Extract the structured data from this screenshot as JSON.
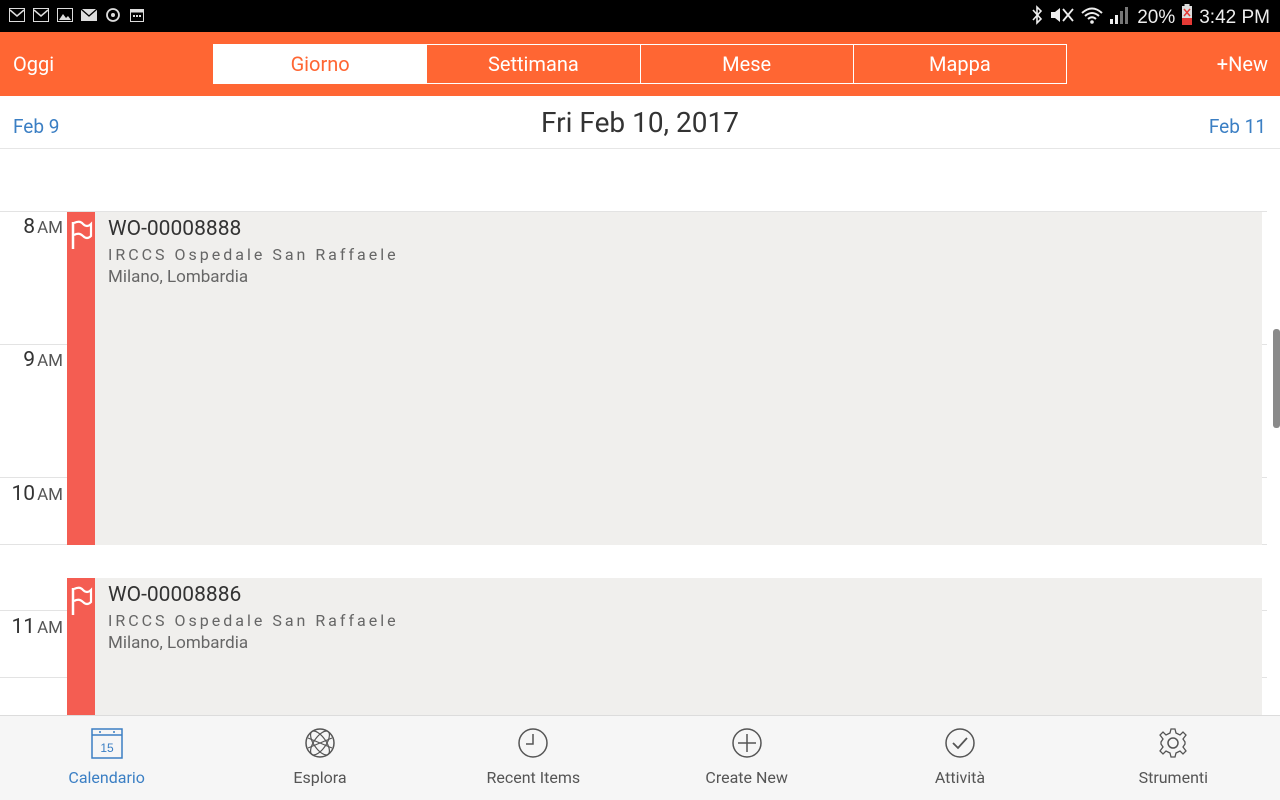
{
  "status_bar": {
    "left_icons": [
      "gmail-icon",
      "gmail-icon",
      "image-icon",
      "mail-icon",
      "sync-icon",
      "calendar-icon"
    ],
    "right_icons": [
      "bluetooth-icon",
      "mute-icon",
      "wifi-icon",
      "signal-icon"
    ],
    "battery": "20%",
    "time": "3:42 PM"
  },
  "toolbar": {
    "today_label": "Oggi",
    "new_label": "+New",
    "tabs": [
      {
        "label": "Giorno",
        "active": true
      },
      {
        "label": "Settimana",
        "active": false
      },
      {
        "label": "Mese",
        "active": false
      },
      {
        "label": "Mappa",
        "active": false
      }
    ],
    "accent_color": "#ff6633"
  },
  "date_nav": {
    "prev": "Feb 9",
    "current": "Fri Feb 10, 2017",
    "next": "Feb 11"
  },
  "hours": [
    {
      "hour": "8",
      "ampm": "AM"
    },
    {
      "hour": "9",
      "ampm": "AM"
    },
    {
      "hour": "10",
      "ampm": "AM"
    },
    {
      "hour": "11",
      "ampm": "AM"
    }
  ],
  "events": [
    {
      "title": "WO-00008888",
      "account": "IRCCS Ospedale San Raffaele",
      "location": "Milano, Lombardia",
      "flag_icon": "flag-icon",
      "color": "#f45d52"
    },
    {
      "title": "WO-00008886",
      "account": "IRCCS Ospedale San Raffaele",
      "location": "Milano, Lombardia",
      "flag_icon": "flag-icon",
      "color": "#f45d52"
    }
  ],
  "bottom_nav": [
    {
      "label": "Calendario",
      "icon": "calendar-icon",
      "calendar_day": "15",
      "active": true
    },
    {
      "label": "Esplora",
      "icon": "globe-icon",
      "active": false
    },
    {
      "label": "Recent Items",
      "icon": "clock-icon",
      "active": false
    },
    {
      "label": "Create New",
      "icon": "plus-circle-icon",
      "active": false
    },
    {
      "label": "Attività",
      "icon": "check-circle-icon",
      "active": false
    },
    {
      "label": "Strumenti",
      "icon": "gear-icon",
      "active": false
    }
  ]
}
